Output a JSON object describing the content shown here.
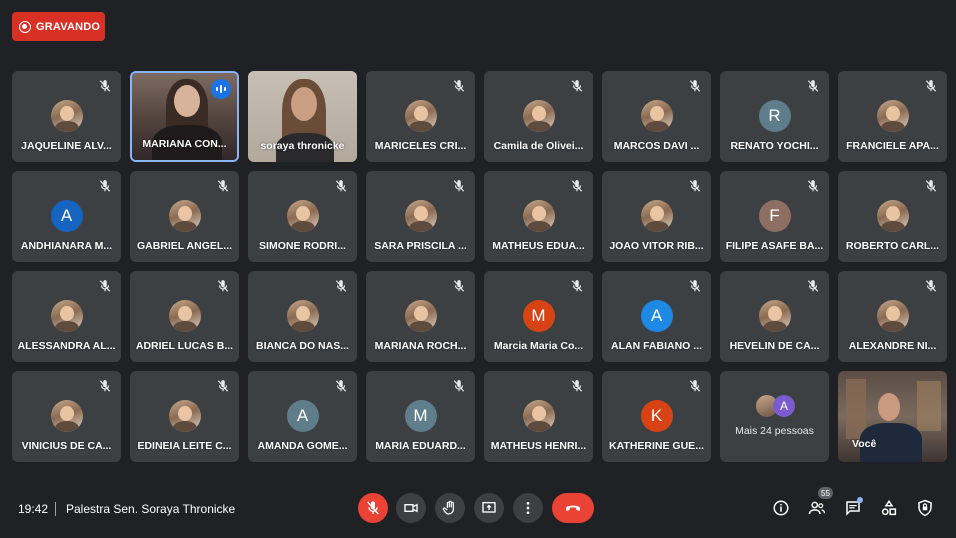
{
  "recording": {
    "label": "GRAVANDO",
    "color": "#d93025"
  },
  "participants": [
    {
      "name": "JAQUELINE ALV...",
      "avatar": "photo",
      "muted": true
    },
    {
      "name": "MARIANA CON...",
      "video": "v1",
      "speaking": true
    },
    {
      "name": "soraya thronicke",
      "video": "v2"
    },
    {
      "name": "MARICELES CRI...",
      "avatar": "photo",
      "muted": true
    },
    {
      "name": "Camila de Olivei...",
      "avatar": "photo",
      "muted": true
    },
    {
      "name": "MARCOS DAVI ...",
      "avatar": "photo",
      "muted": true
    },
    {
      "name": "RENATO YOCHI...",
      "avatar": "letter",
      "letter": "R",
      "color": "#5f7c8a",
      "muted": true
    },
    {
      "name": "FRANCIELE APA...",
      "avatar": "photo",
      "muted": true
    },
    {
      "name": "ANDHIANARA M...",
      "avatar": "letter",
      "letter": "A",
      "color": "#1565c0",
      "muted": true
    },
    {
      "name": "GABRIEL ANGEL...",
      "avatar": "photo",
      "muted": true
    },
    {
      "name": "SIMONE RODRI...",
      "avatar": "photo",
      "muted": true
    },
    {
      "name": "SARA PRISCILA ...",
      "avatar": "photo",
      "muted": true
    },
    {
      "name": "MATHEUS EDUA...",
      "avatar": "photo",
      "muted": true
    },
    {
      "name": "JOAO VITOR RIB...",
      "avatar": "photo",
      "muted": true
    },
    {
      "name": "FILIPE ASAFE BA...",
      "avatar": "letter",
      "letter": "F",
      "color": "#8d6e63",
      "muted": true
    },
    {
      "name": "ROBERTO CARL...",
      "avatar": "photo",
      "muted": true
    },
    {
      "name": "ALESSANDRA AL...",
      "avatar": "photo",
      "muted": true
    },
    {
      "name": "ADRIEL LUCAS B...",
      "avatar": "photo",
      "muted": true
    },
    {
      "name": "BIANCA DO NAS...",
      "avatar": "photo",
      "muted": true
    },
    {
      "name": "MARIANA ROCH...",
      "avatar": "photo",
      "muted": true
    },
    {
      "name": "Marcia Maria Co...",
      "avatar": "letter",
      "letter": "M",
      "color": "#d84315",
      "muted": true
    },
    {
      "name": "ALAN FABIANO ...",
      "avatar": "letter",
      "letter": "A",
      "color": "#1e88e5",
      "muted": true
    },
    {
      "name": "HEVELIN DE CA...",
      "avatar": "photo",
      "muted": true
    },
    {
      "name": "ALEXANDRE NI...",
      "avatar": "photo",
      "muted": true
    },
    {
      "name": "VINICIUS DE CA...",
      "avatar": "photo",
      "muted": true
    },
    {
      "name": "EDINEIA LEITE C...",
      "avatar": "photo",
      "muted": true
    },
    {
      "name": "AMANDA GOME...",
      "avatar": "letter",
      "letter": "A",
      "color": "#5f7c8a",
      "muted": true
    },
    {
      "name": "MARIA EDUARD...",
      "avatar": "letter",
      "letter": "M",
      "color": "#607d8b",
      "muted": true
    },
    {
      "name": "MATHEUS HENRI...",
      "avatar": "photo",
      "muted": true
    },
    {
      "name": "KATHERINE GUE...",
      "avatar": "letter",
      "letter": "K",
      "color": "#d84315",
      "muted": true
    }
  ],
  "more_tile": {
    "label": "Mais 24 pessoas",
    "letter": "A"
  },
  "self_tile": {
    "name": "Você"
  },
  "bottom_bar": {
    "time": "19:42",
    "meeting_title": "Palestra Sen. Soraya Thronicke",
    "people_count": "55",
    "controls": [
      "mic-off-icon",
      "camera-icon",
      "raise-hand-icon",
      "present-icon",
      "more-options-icon",
      "end-call-icon"
    ],
    "right_icons": [
      "info-icon",
      "people-icon",
      "chat-icon",
      "activities-icon",
      "host-controls-icon"
    ]
  }
}
